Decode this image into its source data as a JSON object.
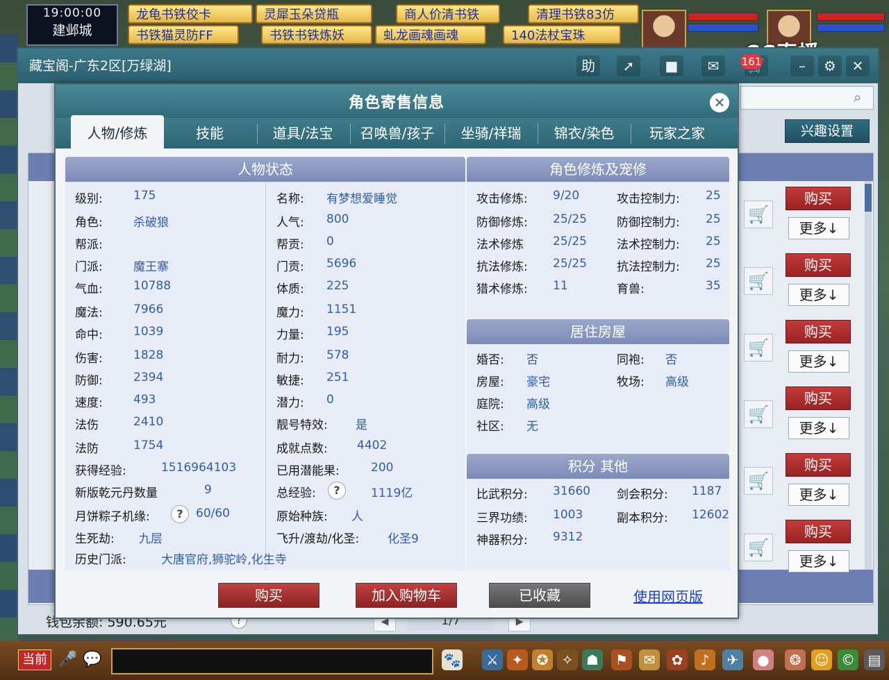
{
  "hud": {
    "clock": "19:00:00",
    "city": "建邺城",
    "top_tabs_row1": [
      "龙龟书铁佼卡",
      "灵犀玉朵贷瓶",
      "商人价清书铁",
      "清理书铁83仿"
    ],
    "top_tabs_row2": [
      "书铁猫灵防FF",
      "书铁书铁炼妖",
      "虬龙画魂画魂",
      "140法杖宝珠"
    ],
    "broadcaster": "CC直播"
  },
  "main_window": {
    "title": "藏宝阁-广东2区[万绿湖]",
    "controls": [
      "助",
      "分享",
      "停",
      "消息",
      "购物车"
    ],
    "cart_badge": "161",
    "interest_button": "兴趣设置",
    "side_buy_label": "购买",
    "side_more_label": "更多↓",
    "wallet": "钱包余额: 590.65元",
    "pager": "1/7"
  },
  "modal": {
    "title": "角色寄售信息",
    "tabs": [
      "人物/修炼",
      "技能",
      "道具/法宝",
      "召唤兽/孩子",
      "坐骑/祥瑞",
      "锦衣/染色",
      "玩家之家"
    ],
    "status": {
      "title": "人物状态",
      "left": [
        {
          "k": "级别:",
          "v": "175"
        },
        {
          "k": "角色:",
          "v": "杀破狼"
        },
        {
          "k": "帮派:",
          "v": ""
        },
        {
          "k": "门派:",
          "v": "魔王寨"
        },
        {
          "k": "气血:",
          "v": "10788"
        },
        {
          "k": "魔法:",
          "v": "7966"
        },
        {
          "k": "命中:",
          "v": "1039"
        },
        {
          "k": "伤害:",
          "v": "1828"
        },
        {
          "k": "防御:",
          "v": "2394"
        },
        {
          "k": "速度:",
          "v": "493"
        },
        {
          "k": "法伤",
          "v": "2410"
        },
        {
          "k": "法防",
          "v": "1754"
        },
        {
          "k": "获得经验:",
          "v": "1516964103"
        },
        {
          "k": "新版乾元丹数量",
          "v": "9"
        },
        {
          "k": "月饼粽子机缘:",
          "v": "60/60"
        },
        {
          "k": "生死劫:",
          "v": "九层"
        },
        {
          "k": "历史门派:",
          "v": "大唐官府,狮驼岭,化生寺"
        }
      ],
      "right": [
        {
          "k": "名称:",
          "v": "有梦想爱睡觉"
        },
        {
          "k": "人气:",
          "v": "800"
        },
        {
          "k": "帮贡:",
          "v": "0"
        },
        {
          "k": "门贡:",
          "v": "5696"
        },
        {
          "k": "体质:",
          "v": "225"
        },
        {
          "k": "魔力:",
          "v": "1151"
        },
        {
          "k": "力量:",
          "v": "195"
        },
        {
          "k": "耐力:",
          "v": "578"
        },
        {
          "k": "敏捷:",
          "v": "251"
        },
        {
          "k": "潜力:",
          "v": "0"
        },
        {
          "k": "靓号特效:",
          "v": "是"
        },
        {
          "k": "成就点数:",
          "v": "4402"
        },
        {
          "k": "已用潜能果:",
          "v": "200"
        },
        {
          "k": "总经验:",
          "v": "1119亿"
        },
        {
          "k": "原始种族:",
          "v": "人"
        },
        {
          "k": "飞升/渡劫/化圣:",
          "v": "化圣9"
        }
      ]
    },
    "cultivation": {
      "title": "角色修炼及宠修",
      "rows": [
        {
          "k1": "攻击修炼:",
          "v1": "9/20",
          "k2": "攻击控制力:",
          "v2": "25"
        },
        {
          "k1": "防御修炼:",
          "v1": "25/25",
          "k2": "防御控制力:",
          "v2": "25"
        },
        {
          "k1": "法术修炼",
          "v1": "25/25",
          "k2": "法术控制力:",
          "v2": "25"
        },
        {
          "k1": "抗法修炼:",
          "v1": "25/25",
          "k2": "抗法控制力:",
          "v2": "25"
        },
        {
          "k1": "猎术修炼:",
          "v1": "11",
          "k2": "育兽:",
          "v2": "35"
        }
      ]
    },
    "housing": {
      "title": "居住房屋",
      "rows": [
        {
          "k1": "婚否:",
          "v1": "否",
          "k2": "同袍:",
          "v2": "否"
        },
        {
          "k1": "房屋:",
          "v1": "豪宅",
          "k2": "牧场:",
          "v2": "高级"
        },
        {
          "k1": "庭院:",
          "v1": "高级",
          "k2": "",
          "v2": ""
        },
        {
          "k1": "社区:",
          "v1": "无",
          "k2": "",
          "v2": ""
        }
      ]
    },
    "points": {
      "title": "积分 其他",
      "rows": [
        {
          "k1": "比武积分:",
          "v1": "31660",
          "k2": "剑会积分:",
          "v2": "1187"
        },
        {
          "k1": "三界功绩:",
          "v1": "1003",
          "k2": "副本积分:",
          "v2": "12602"
        },
        {
          "k1": "神器积分:",
          "v1": "9312",
          "k2": "",
          "v2": ""
        }
      ]
    },
    "buttons": {
      "buy": "购买",
      "add_cart": "加入购物车",
      "favorited": "已收藏",
      "web": "使用网页版"
    },
    "qmark": "?"
  },
  "taskbar": {
    "now": "当前"
  }
}
